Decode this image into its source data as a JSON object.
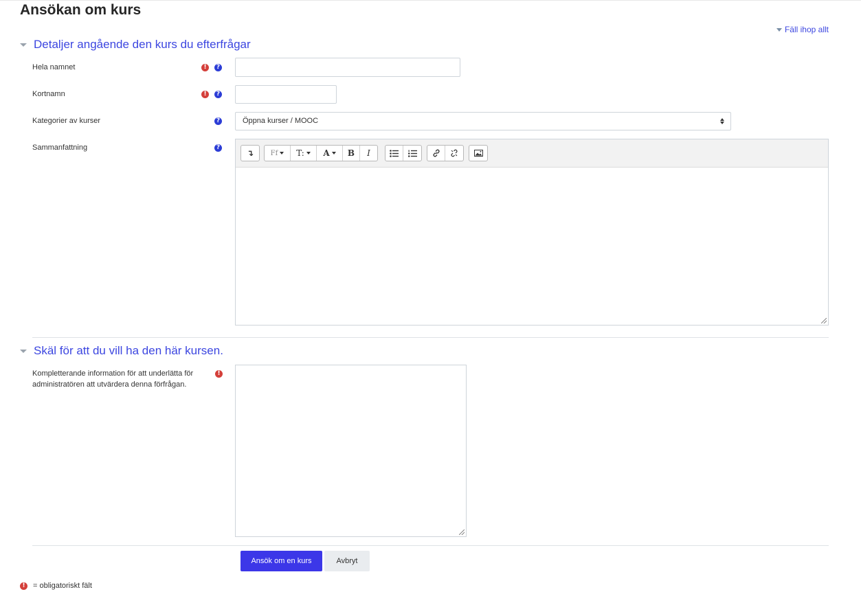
{
  "page": {
    "title": "Ansökan om kurs",
    "collapse_all": "Fäll ihop allt"
  },
  "sections": [
    {
      "title": "Detaljer angående den kurs du efterfrågar"
    },
    {
      "title": "Skäl för att du vill ha den här kursen."
    }
  ],
  "fields": {
    "fullname": {
      "label": "Hela namnet",
      "value": ""
    },
    "shortname": {
      "label": "Kortnamn",
      "value": ""
    },
    "category": {
      "label": "Kategorier av kurser",
      "selected": "Öppna kurser / MOOC"
    },
    "summary": {
      "label": "Sammanfattning",
      "value": ""
    },
    "reason": {
      "label_line1": "Kompletterande information för att underlätta för",
      "label_line2": "administratören att utvärdera denna förfrågan.",
      "value": ""
    }
  },
  "toolbar": {
    "show_more": "↴",
    "font": "Ff",
    "font_size": "T:",
    "color": "A",
    "bold": "B",
    "italic": "I"
  },
  "buttons": {
    "submit": "Ansök om en kurs",
    "cancel": "Avbryt"
  },
  "legend": {
    "required_note": "= obligatoriskt fält"
  },
  "colors": {
    "accent": "#3c46e0",
    "required": "#d43f3a",
    "primary_button": "#3c37e8"
  }
}
